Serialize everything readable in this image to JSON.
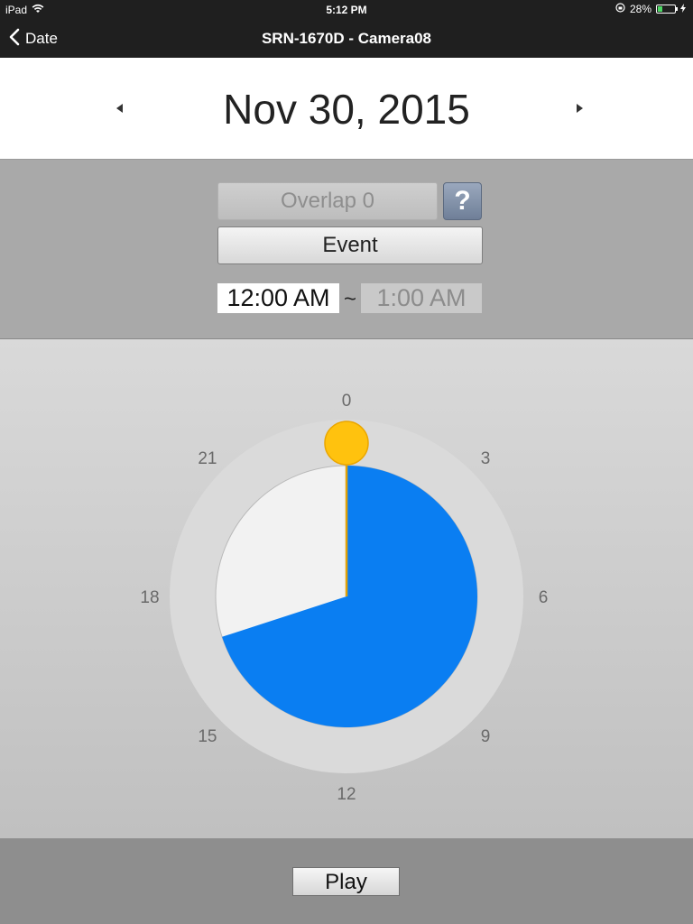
{
  "status_bar": {
    "device": "iPad",
    "time": "5:12 PM",
    "battery": "28%",
    "battery_level": 0.28
  },
  "nav": {
    "back_label": "Date",
    "title": "SRN-1670D - Camera08"
  },
  "date_header": {
    "date": "Nov 30, 2015"
  },
  "controls": {
    "overlap_label": "Overlap 0",
    "help_label": "?",
    "event_label": "Event",
    "time_start": "12:00 AM",
    "separator": "~",
    "time_end": "1:00 AM"
  },
  "dial": {
    "hour_labels": [
      "0",
      "3",
      "6",
      "9",
      "12",
      "15",
      "18",
      "21"
    ],
    "recorded_fraction": 0.7,
    "recorded_color": "#0a7ef2",
    "empty_color": "#f2f2f2",
    "handle_color": "#ffc20e"
  },
  "bottom": {
    "play_label": "Play"
  }
}
